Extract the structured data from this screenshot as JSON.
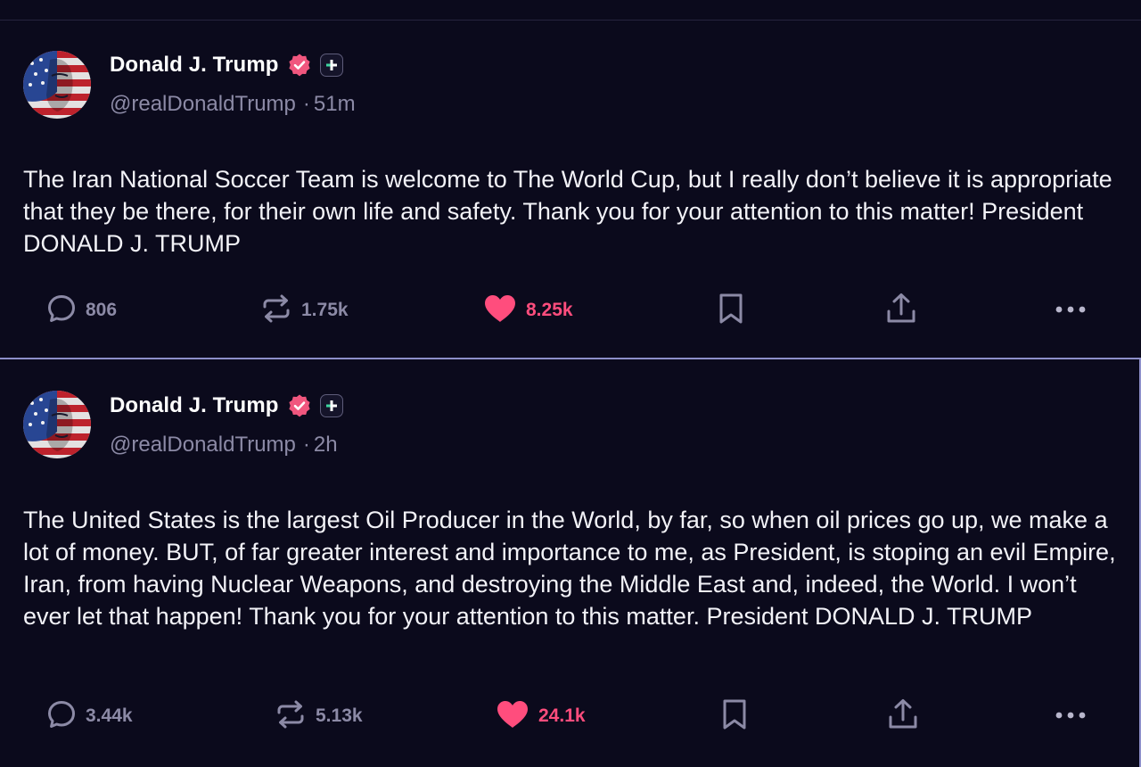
{
  "posts": [
    {
      "author": {
        "display_name": "Donald J. Trump",
        "handle": "@realDonaldTrump",
        "verified": true,
        "avatar": "american-flag-portrait"
      },
      "time_separator": "·",
      "timestamp": "51m",
      "body": "The Iran National Soccer Team is welcome to The World Cup, but I really don’t believe it is appropriate that they be there, for their own life and safety. Thank you for your attention to this matter! President DONALD J. TRUMP",
      "stats": {
        "replies": "806",
        "reposts": "1.75k",
        "likes": "8.25k"
      },
      "liked": true
    },
    {
      "author": {
        "display_name": "Donald J. Trump",
        "handle": "@realDonaldTrump",
        "verified": true,
        "avatar": "american-flag-portrait"
      },
      "time_separator": "·",
      "timestamp": "2h",
      "body": "The United States is the largest Oil Producer in the World, by far, so when oil prices go up, we make a lot of money. BUT, of far greater interest and importance to me, as President, is stoping an evil Empire, Iran, from having Nuclear Weapons, and destroying the Middle East and, indeed, the World. I won’t ever let that happen! Thank you for your attention to this matter. President DONALD J. TRUMP",
      "stats": {
        "replies": "3.44k",
        "reposts": "5.13k",
        "likes": "24.1k"
      },
      "liked": true
    }
  ],
  "icons": {
    "reply": "speech-bubble-icon",
    "repost": "repost-arrows-icon",
    "like": "heart-icon",
    "bookmark": "bookmark-icon",
    "share": "upload-share-icon",
    "more": "ellipsis-icon",
    "verified": "verified-badge-icon",
    "plus": "plus-badge-icon"
  },
  "colors": {
    "background": "#0b0a1c",
    "accent_like": "#ff4d7d",
    "verified": "#f0567e",
    "muted_text": "#8c8aa6",
    "selected_border": "#8d8fc9"
  }
}
